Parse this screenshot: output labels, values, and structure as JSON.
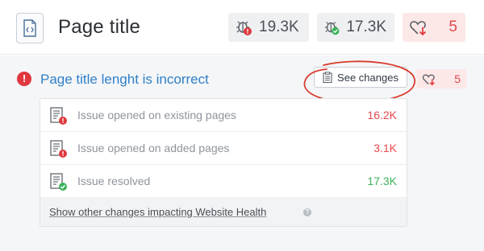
{
  "header": {
    "title": "Page title",
    "page_icon": "code-file-icon",
    "stats": {
      "issues": {
        "value": "19.3K",
        "icon": "bug-alert-icon"
      },
      "resolved": {
        "value": "17.3K",
        "icon": "bug-check-icon"
      },
      "health": {
        "value": "5",
        "icon": "heart-down-icon"
      }
    }
  },
  "issue": {
    "title": "Page title lenght is incorrect",
    "alert_icon": "!",
    "see_changes_label": "See changes",
    "health_value": "5",
    "rows": [
      {
        "label": "Issue opened on existing pages",
        "value": "16.2K",
        "status": "error"
      },
      {
        "label": "Issue opened on added pages",
        "value": "3.1K",
        "status": "error"
      },
      {
        "label": "Issue resolved",
        "value": "17.3K",
        "status": "success"
      }
    ],
    "footer_link": "Show other changes impacting Website Health",
    "help_icon": "?"
  },
  "colors": {
    "accent_blue": "#2f80c8",
    "error_red": "#e6494f",
    "success_green": "#3bb35a",
    "annotation_red": "#d93a2b"
  }
}
